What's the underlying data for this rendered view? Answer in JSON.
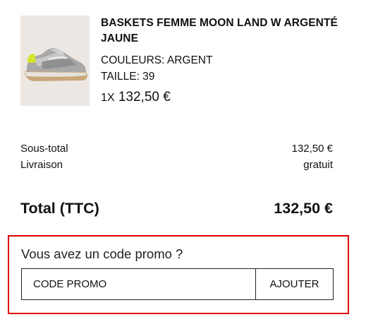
{
  "product": {
    "name": "BASKETS FEMME MOON LAND W ARGENTÉ JAUNE",
    "color_line": "COULEURS: ARGENT",
    "size_line": "TAILLE: 39",
    "quantity": "1X",
    "price": "132,50 €",
    "image_icon": "sneaker-icon"
  },
  "summary": {
    "subtotal_label": "Sous-total",
    "subtotal_value": "132,50 €",
    "shipping_label": "Livraison",
    "shipping_value": "gratuit",
    "total_label": "Total (TTC)",
    "total_value": "132,50 €"
  },
  "promo": {
    "title": "Vous avez un code promo ?",
    "input_placeholder": "CODE PROMO",
    "input_value": "",
    "button_label": "AJOUTER",
    "highlight_color": "#e00000"
  }
}
